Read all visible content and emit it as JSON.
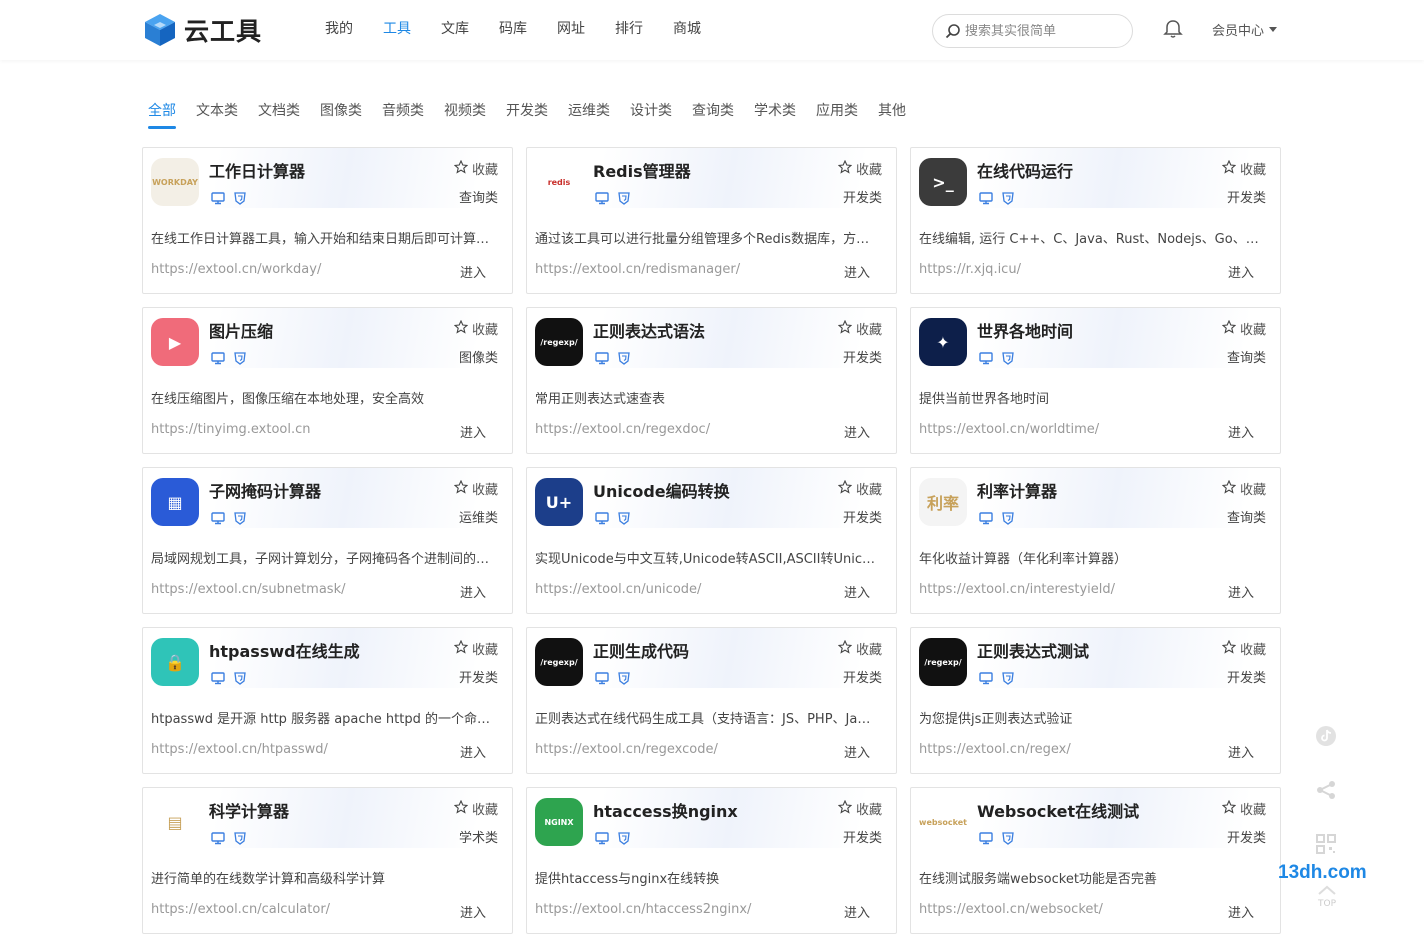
{
  "header": {
    "brand": "云工具",
    "nav": [
      "我的",
      "工具",
      "文库",
      "码库",
      "网址",
      "排行",
      "商城"
    ],
    "nav_active": 1,
    "search_placeholder": "搜索其实很简单",
    "member": "会员中心"
  },
  "categories": [
    "全部",
    "文本类",
    "文档类",
    "图像类",
    "音频类",
    "视频类",
    "开发类",
    "运维类",
    "设计类",
    "查询类",
    "学术类",
    "应用类",
    "其他"
  ],
  "fav_label": "收藏",
  "enter_label": "进入",
  "tools": [
    {
      "title": "工作日计算器",
      "type": "查询类",
      "desc": "在线工作日计算器工具，输入开始和结束日期后即可计算两个日期间的工作日天数",
      "url": "https://extool.cn/workday/",
      "icon": "workday-icon",
      "color": "#f3efe6",
      "icon_text": "WORKDAY"
    },
    {
      "title": "Redis管理器",
      "type": "开发类",
      "desc": "通过该工具可以进行批量分组管理多个Redis数据库，方便快捷",
      "url": "https://extool.cn/redismanager/",
      "icon": "redis-icon",
      "color": "#ffffff",
      "icon_text": "redis"
    },
    {
      "title": "在线代码运行",
      "type": "开发类",
      "desc": "在线编辑, 运行 C++、C、Java、Rust、Nodejs、Go、Python等代码",
      "url": "https://r.xjq.icu/",
      "icon": "terminal-icon",
      "color": "#3b3b3b",
      "icon_text": ">_"
    },
    {
      "title": "图片压缩",
      "type": "图像类",
      "desc": "在线压缩图片，图像压缩在本地处理，安全高效",
      "url": "https://tinyimg.extool.cn",
      "icon": "image-compress-icon",
      "color": "#f06b7a",
      "icon_text": "▶"
    },
    {
      "title": "正则表达式语法",
      "type": "开发类",
      "desc": "常用正则表达式速查表",
      "url": "https://extool.cn/regexdoc/",
      "icon": "regexp-icon",
      "color": "#111111",
      "icon_text": "/regexp/"
    },
    {
      "title": "世界各地时间",
      "type": "查询类",
      "desc": "提供当前世界各地时间",
      "url": "https://extool.cn/worldtime/",
      "icon": "world-clock-icon",
      "color": "#0d1f4a",
      "icon_text": "✦"
    },
    {
      "title": "子网掩码计算器",
      "type": "运维类",
      "desc": "局域网规划工具，子网计算划分，子网掩码各个进制间的转换计算",
      "url": "https://extool.cn/subnetmask/",
      "icon": "subnet-icon",
      "color": "#2a5bd7",
      "icon_text": "▦"
    },
    {
      "title": "Unicode编码转换",
      "type": "开发类",
      "desc": "实现Unicode与中文互转,Unicode转ASCII,ASCII转Unicode等",
      "url": "https://extool.cn/unicode/",
      "icon": "unicode-icon",
      "color": "#1c3e8a",
      "icon_text": "U+"
    },
    {
      "title": "利率计算器",
      "type": "查询类",
      "desc": "年化收益计算器（年化利率计算器）",
      "url": "https://extool.cn/interestyield/",
      "icon": "interest-icon",
      "color": "#f4f4f4",
      "icon_text": "利率"
    },
    {
      "title": "htpasswd在线生成",
      "type": "开发类",
      "desc": "htpasswd 是开源 http 服务器 apache httpd 的一个命令工具，用于生成密码文件",
      "url": "https://extool.cn/htpasswd/",
      "icon": "lock-icon",
      "color": "#2fc4b8",
      "icon_text": "🔒"
    },
    {
      "title": "正则生成代码",
      "type": "开发类",
      "desc": "正则表达式在线代码生成工具（支持语言：JS、PHP、Java、Python等）",
      "url": "https://extool.cn/regexcode/",
      "icon": "regexp-icon",
      "color": "#111111",
      "icon_text": "/regexp/"
    },
    {
      "title": "正则表达式测试",
      "type": "开发类",
      "desc": "为您提供js正则表达式验证",
      "url": "https://extool.cn/regex/",
      "icon": "regexp-icon",
      "color": "#111111",
      "icon_text": "/regexp/"
    },
    {
      "title": "科学计算器",
      "type": "学术类",
      "desc": "进行简单的在线数学计算和高级科学计算",
      "url": "https://extool.cn/calculator/",
      "icon": "calculator-icon",
      "color": "#ffffff",
      "icon_text": "▤"
    },
    {
      "title": "htaccess换nginx",
      "type": "开发类",
      "desc": "提供htaccess与nginx在线转换",
      "url": "https://extool.cn/htaccess2nginx/",
      "icon": "nginx-icon",
      "color": "#2ea44f",
      "icon_text": "NGINX"
    },
    {
      "title": "Websocket在线测试",
      "type": "开发类",
      "desc": "在线测试服务端websocket功能是否完善",
      "url": "https://extool.cn/websocket/",
      "icon": "websocket-icon",
      "color": "#ffffff",
      "icon_text": "websocket"
    }
  ],
  "side": {
    "brand": "13dh.com",
    "top": "TOP"
  }
}
